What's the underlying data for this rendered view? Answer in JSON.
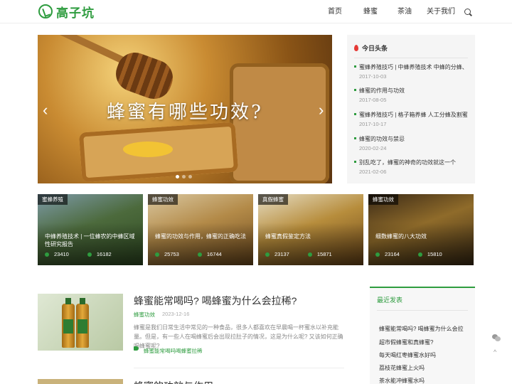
{
  "header": {
    "logo_text": "高子坑",
    "nav": [
      "首页",
      "蜂蜜",
      "茶油",
      "关于我们"
    ]
  },
  "slider": {
    "title": "蜂蜜有哪些功效?",
    "prev": "‹",
    "next": "›"
  },
  "headlines": {
    "title": "今日头条",
    "items": [
      {
        "title": "蜜蜂养殖技巧 | 中蜂养殖技术 中蜂的分蜂、换",
        "date": "2017-10-03"
      },
      {
        "title": "蜂蜜的作用与功效",
        "date": "2017-08-05"
      },
      {
        "title": "蜜蜂养殖技巧 | 格子箱养蜂 人工分蜂及割蜜管",
        "date": "2017-10-17"
      },
      {
        "title": "蜂蜜的功效与禁忌",
        "date": "2020-02-24"
      },
      {
        "title": "别乱吃了，蜂蜜的神奇的功效就这一个",
        "date": "2021-02-06"
      }
    ]
  },
  "cards": [
    {
      "tag": "蜜蜂养殖",
      "title": "中蜂养殖技术 | 一位蜂农的中蜂区域性研究报告",
      "views": "23410",
      "likes": "16182"
    },
    {
      "tag": "蜂蜜功效",
      "title": "蜂蜜的功效与作用，蜂蜜的正确吃法",
      "views": "25753",
      "likes": "16744"
    },
    {
      "tag": "真假蜂蜜",
      "title": "蜂蜜真假鉴定方法",
      "views": "23137",
      "likes": "15871"
    },
    {
      "tag": "蜂蜜功效",
      "title": "细数蜂蜜的八大功效",
      "views": "23164",
      "likes": "15810"
    }
  ],
  "article": {
    "title": "蜂蜜能常喝吗? 喝蜂蜜为什么会拉稀?",
    "category": "蜂蜜功效",
    "date": "2023-12-16",
    "excerpt": "蜂蜜是我们日常生活中常见的一种食品，很多人都喜欢在早晨喝一杯蜜水以补充能量。但是，有一些人在喝蜂蜜后会出现拉肚子的情况，这是为什么呢? 又该如何正确喝蜂蜜呢?",
    "tags": [
      "蜂蜜能常喝吗",
      "喝蜂蜜拉稀"
    ],
    "next_title": "蜂蜜的功效与作用"
  },
  "recent": {
    "title": "最近发表",
    "items": [
      "蜂蜜能常喝吗? 喝蜂蜜为什么会拉",
      "超市假蜂蜜和真蜂蜜?",
      "每天喝红枣蜂蜜水好吗",
      "荔枝花蜂蜜上火吗",
      "茶水能冲蜂蜜水吗"
    ]
  },
  "floating": {
    "top": "^"
  }
}
